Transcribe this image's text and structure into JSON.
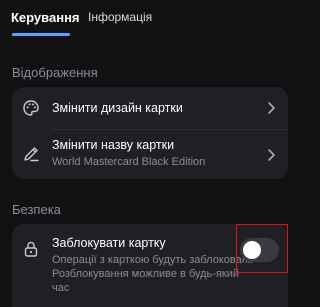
{
  "tabs": [
    {
      "label": "Керування",
      "active": true
    },
    {
      "label": "Інформація",
      "active": false
    }
  ],
  "colors": {
    "accent": "#5aa2ff",
    "background": "#111114",
    "card": "#1f1f24",
    "highlight": "#e0111b"
  },
  "display_section": {
    "title": "Відображення",
    "items": [
      {
        "icon": "palette-icon",
        "label": "Змінити дизайн картки"
      },
      {
        "icon": "edit-pencil-icon",
        "label": "Змінити назву картки",
        "sublabel": "World Mastercard Black Edition"
      }
    ]
  },
  "security_section": {
    "title": "Безпека",
    "lock_item": {
      "icon": "lock-icon",
      "label": "Заблокувати картку",
      "description_line1": "Операції з карткою будуть заблоковані.",
      "description_line2": "Розблокування можливе в будь-який",
      "description_line3": "час",
      "toggle_on": false
    }
  }
}
